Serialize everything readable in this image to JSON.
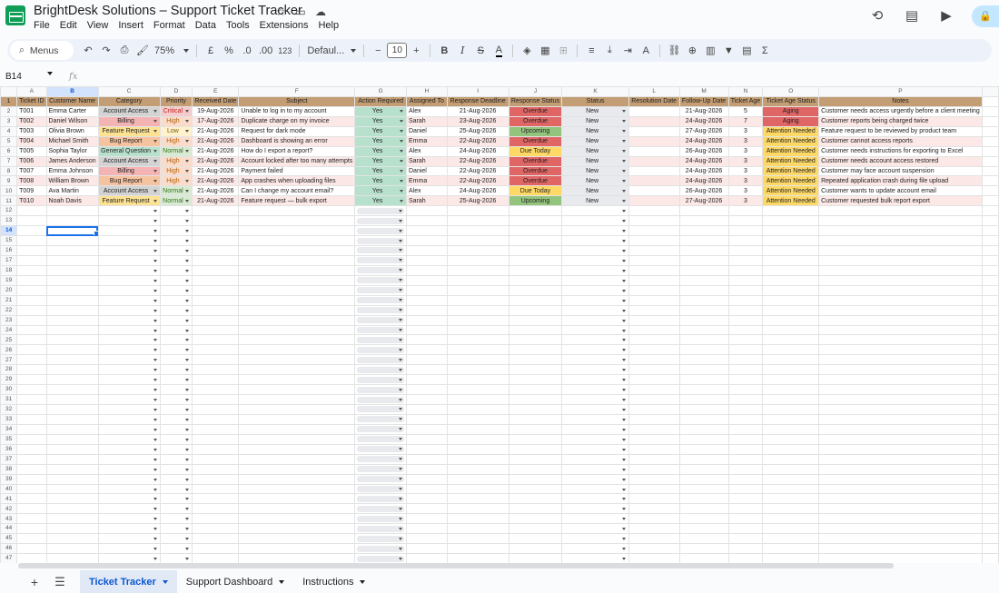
{
  "app": {
    "title": "BrightDesk Solutions – Support Ticket Tracker",
    "menus": [
      "File",
      "Edit",
      "View",
      "Insert",
      "Format",
      "Data",
      "Tools",
      "Extensions",
      "Help"
    ]
  },
  "toolbar": {
    "search_label": "Menus",
    "zoom": "75%",
    "currency": "£",
    "percent": "%",
    "dec_decrease": ".0",
    "dec_increase": ".00",
    "number_format": "123",
    "font": "Defaul...",
    "font_size": "10",
    "bold": "B",
    "italic": "I",
    "strike": "S",
    "text_color": "A"
  },
  "formula_bar": {
    "cell_ref": "B14",
    "fx": "fx",
    "content": ""
  },
  "columns": [
    "A",
    "B",
    "C",
    "D",
    "E",
    "F",
    "G",
    "H",
    "I",
    "J",
    "K",
    "L",
    "M",
    "N",
    "O",
    "P"
  ],
  "headers": [
    "Ticket ID",
    "Customer Name",
    "Category",
    "Priority",
    "Received Date",
    "Subject",
    "Action Required",
    "Assigned To",
    "Response Deadline",
    "Response Status",
    "Status",
    "Resolution Date",
    "Follow-Up Date",
    "Ticket Age",
    "Ticket Age Status",
    "Notes"
  ],
  "rows": [
    {
      "id": "T001",
      "name": "Emma Carter",
      "category": "Account Access",
      "priority": "Critical",
      "received": "19-Aug-2026",
      "subject": "Unable to log in to my account",
      "action": "Yes",
      "assigned": "Alex",
      "deadline": "21-Aug-2026",
      "resp_status": "Overdue",
      "status": "New",
      "resolution": "",
      "followup": "21-Aug-2026",
      "age": "5",
      "age_status": "Aging",
      "notes": "Customer needs access urgently before a client meeting"
    },
    {
      "id": "T002",
      "name": "Daniel Wilson",
      "category": "Billing",
      "priority": "High",
      "received": "17-Aug-2026",
      "subject": "Duplicate charge on my invoice",
      "action": "Yes",
      "assigned": "Sarah",
      "deadline": "23-Aug-2026",
      "resp_status": "Overdue",
      "status": "New",
      "resolution": "",
      "followup": "24-Aug-2026",
      "age": "7",
      "age_status": "Aging",
      "notes": "Customer reports being charged twice"
    },
    {
      "id": "T003",
      "name": "Olivia Brown",
      "category": "Feature Request",
      "priority": "Low",
      "received": "21-Aug-2026",
      "subject": "Request for dark mode",
      "action": "Yes",
      "assigned": "Daniel",
      "deadline": "25-Aug-2026",
      "resp_status": "Upcoming",
      "status": "New",
      "resolution": "",
      "followup": "27-Aug-2026",
      "age": "3",
      "age_status": "Attention Needed",
      "notes": "Feature request to be reviewed by product team"
    },
    {
      "id": "T004",
      "name": "Michael Smith",
      "category": "Bug Report",
      "priority": "High",
      "received": "21-Aug-2026",
      "subject": "Dashboard is showing an error",
      "action": "Yes",
      "assigned": "Emma",
      "deadline": "22-Aug-2026",
      "resp_status": "Overdue",
      "status": "New",
      "resolution": "",
      "followup": "24-Aug-2026",
      "age": "3",
      "age_status": "Attention Needed",
      "notes": "Customer cannot access reports"
    },
    {
      "id": "T005",
      "name": "Sophia Taylor",
      "category": "General Question",
      "priority": "Normal",
      "received": "21-Aug-2026",
      "subject": "How do I export a report?",
      "action": "Yes",
      "assigned": "Alex",
      "deadline": "24-Aug-2026",
      "resp_status": "Due Today",
      "status": "New",
      "resolution": "",
      "followup": "26-Aug-2026",
      "age": "3",
      "age_status": "Attention Needed",
      "notes": "Customer needs instructions for exporting to Excel"
    },
    {
      "id": "T006",
      "name": "James Anderson",
      "category": "Account Access",
      "priority": "High",
      "received": "21-Aug-2026",
      "subject": "Account locked after too many attempts",
      "action": "Yes",
      "assigned": "Sarah",
      "deadline": "22-Aug-2026",
      "resp_status": "Overdue",
      "status": "New",
      "resolution": "",
      "followup": "24-Aug-2026",
      "age": "3",
      "age_status": "Attention Needed",
      "notes": "Customer needs account access restored"
    },
    {
      "id": "T007",
      "name": "Emma Johnson",
      "category": "Billing",
      "priority": "High",
      "received": "21-Aug-2026",
      "subject": "Payment failed",
      "action": "Yes",
      "assigned": "Daniel",
      "deadline": "22-Aug-2026",
      "resp_status": "Overdue",
      "status": "New",
      "resolution": "",
      "followup": "24-Aug-2026",
      "age": "3",
      "age_status": "Attention Needed",
      "notes": "Customer may face account suspension"
    },
    {
      "id": "T008",
      "name": "William Brown",
      "category": "Bug Report",
      "priority": "High",
      "received": "21-Aug-2026",
      "subject": "App crashes when uploading files",
      "action": "Yes",
      "assigned": "Emma",
      "deadline": "22-Aug-2026",
      "resp_status": "Overdue",
      "status": "New",
      "resolution": "",
      "followup": "24-Aug-2026",
      "age": "3",
      "age_status": "Attention Needed",
      "notes": "Repeated application crash during file upload"
    },
    {
      "id": "T009",
      "name": "Ava Martin",
      "category": "Account Access",
      "priority": "Normal",
      "received": "21-Aug-2026",
      "subject": "Can I change my account email?",
      "action": "Yes",
      "assigned": "Alex",
      "deadline": "24-Aug-2026",
      "resp_status": "Due Today",
      "status": "New",
      "resolution": "",
      "followup": "26-Aug-2026",
      "age": "3",
      "age_status": "Attention Needed",
      "notes": "Customer wants to update account email"
    },
    {
      "id": "T010",
      "name": "Noah Davis",
      "category": "Feature Request",
      "priority": "Normal",
      "received": "21-Aug-2026",
      "subject": "Feature request — bulk export",
      "action": "Yes",
      "assigned": "Sarah",
      "deadline": "25-Aug-2026",
      "resp_status": "Upcoming",
      "status": "New",
      "resolution": "",
      "followup": "27-Aug-2026",
      "age": "3",
      "age_status": "Attention Needed",
      "notes": "Customer requested bulk report export"
    }
  ],
  "empty_row_start": 12,
  "empty_row_end": 47,
  "active_row": 14,
  "colors": {
    "header_fill": "#c39d73",
    "row_odd": "#ffffff",
    "row_even": "#fce8e6",
    "category": {
      "Account Access": "#d3d3d3",
      "Billing": "#f4b4b4",
      "Feature Request": "#fde293",
      "Bug Report": "#f6c3a0",
      "General Question": "#b7e1cd"
    },
    "priority": {
      "Critical": "#f4cccc",
      "High": "#fbdccb",
      "Low": "#fff2cc",
      "Normal": "#d9ead3"
    },
    "priority_text": {
      "Critical": "#c5221f",
      "High": "#b45f06",
      "Low": "#7f6000",
      "Normal": "#38761d"
    },
    "action_yes": "#b7e1cd",
    "resp_status": {
      "Overdue": "#e06666",
      "Upcoming": "#93c47d",
      "Due Today": "#ffd966"
    },
    "status_new": "#e8eaed",
    "age_status": {
      "Aging": "#e06666",
      "Attention Needed": "#ffd966"
    },
    "selection": "#1a73e8"
  },
  "sheet_tabs": [
    {
      "label": "Ticket Tracker",
      "active": true
    },
    {
      "label": "Support Dashboard",
      "active": false
    },
    {
      "label": "Instructions",
      "active": false
    }
  ]
}
